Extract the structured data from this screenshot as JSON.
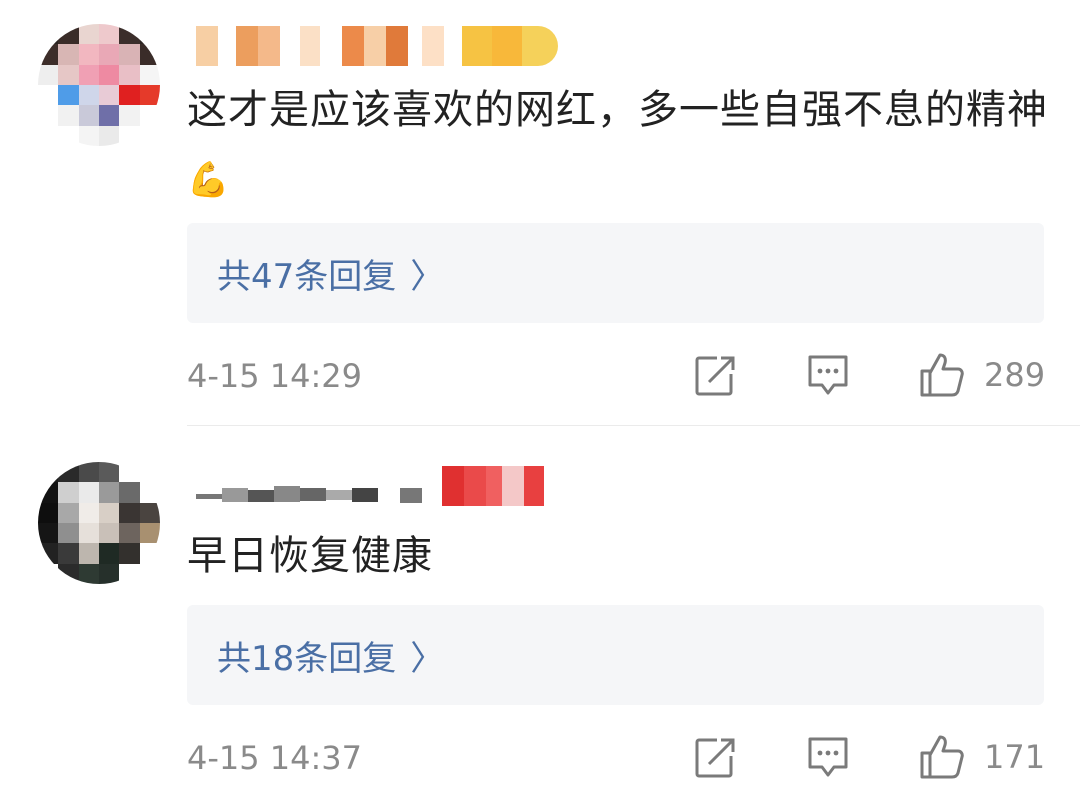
{
  "comments": [
    {
      "content": "这才是应该喜欢的网红，多一些自强不息的精神",
      "emoji": "💪",
      "reply_label": "共47条回复",
      "reply_chevron": "〉",
      "time": "4-15 14:29",
      "likes": "289",
      "icons": [
        "share-icon",
        "comment-icon",
        "thumbs-up-icon"
      ]
    },
    {
      "content": "早日恢复健康",
      "reply_label": "共18条回复",
      "reply_chevron": "〉",
      "time": "4-15 14:37",
      "likes": "171",
      "icons": [
        "share-icon",
        "comment-icon",
        "thumbs-up-icon"
      ]
    }
  ],
  "colors": {
    "reply_link": "#4a6fa5",
    "meta_gray": "#8a8a8a",
    "reply_bg": "#f5f6f8"
  }
}
